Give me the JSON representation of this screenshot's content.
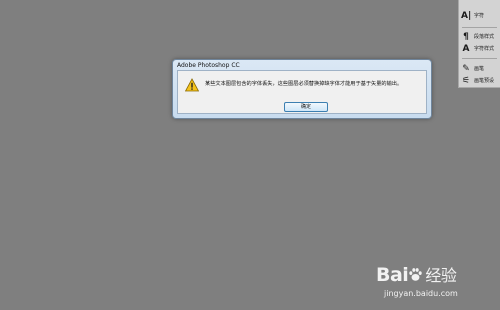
{
  "panel": {
    "items": [
      {
        "icon": "character-panel-icon",
        "label": "字符"
      },
      {
        "icon": "paragraph-styles-icon",
        "label": "段落样式"
      },
      {
        "icon": "character-styles-icon",
        "label": "字符样式"
      },
      {
        "icon": "brush-icon",
        "label": "画笔"
      },
      {
        "icon": "brush-presets-icon",
        "label": "画笔预设"
      }
    ]
  },
  "dialog": {
    "title": "Adobe Photoshop CC",
    "message": "某些文本图层包含的字体丢失，这些图层必须替换掉缺字体才能用于基于矢量的输出。",
    "ok_label": "确定",
    "icon": "warning-icon"
  },
  "watermark": {
    "logo_text": "Bai",
    "logo_suffix": "经验",
    "url": "jingyan.baidu.com"
  }
}
